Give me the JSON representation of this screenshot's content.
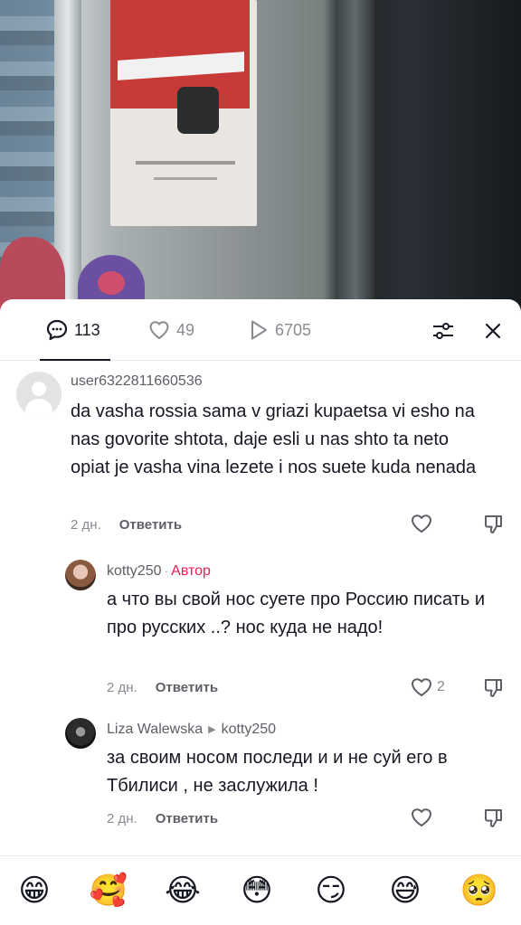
{
  "stats": {
    "comments_count": "113",
    "likes_count": "49",
    "views_count": "6705"
  },
  "comments": [
    {
      "username": "user6322811660536",
      "text": "da vasha rossia sama v griazi kupaetsa vi esho na nas govorite shtota, daje esli u nas shto ta neto opiat je vasha vina lezete i nos suete kuda nenada",
      "time": "2 дн.",
      "reply_label": "Ответить",
      "likes": ""
    },
    {
      "username": "kotty250",
      "author_label": "Автор",
      "text": "а что вы свой нос суете про Россию писать и про русских ..? нос куда не надо!",
      "time": "2 дн.",
      "reply_label": "Ответить",
      "likes": "2"
    },
    {
      "username": "Liza Walewska",
      "reply_to": "kotty250",
      "text": "за своим носом последи и и не суй его в Тбилиси , не заслужила !",
      "time": "2 дн.",
      "reply_label": "Ответить",
      "likes": ""
    }
  ],
  "emoji_bar": [
    "😁",
    "🥰",
    "😂",
    "😳",
    "😏",
    "😅",
    "🥺"
  ]
}
